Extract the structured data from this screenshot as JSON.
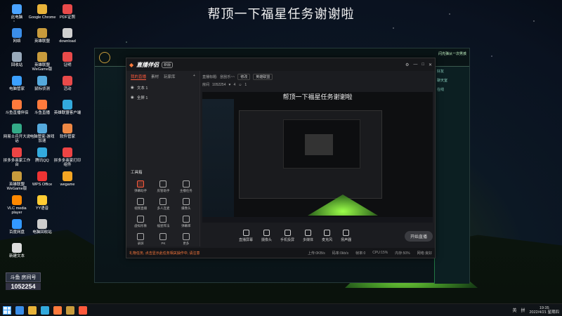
{
  "overlay_title": "帮顶一下福星任务谢谢啦",
  "desktop_icons": [
    {
      "label": "此电脑",
      "color": "#4aa3ff"
    },
    {
      "label": "Google Chrome",
      "color": "#e8b339"
    },
    {
      "label": "PDF证照",
      "color": "#e84a4a"
    },
    {
      "label": "网络",
      "color": "#3b8ee8"
    },
    {
      "label": "英雄联盟",
      "color": "#c89b3c"
    },
    {
      "label": "download",
      "color": "#d0d0d0"
    },
    {
      "label": "回收站",
      "color": "#9ab"
    },
    {
      "label": "英雄联盟WeGame版",
      "color": "#c89b3c"
    },
    {
      "label": "证明",
      "color": "#e84a4a"
    },
    {
      "label": "电脑管家",
      "color": "#3ba0ff"
    },
    {
      "label": "鼠标侦测",
      "color": "#5ad"
    },
    {
      "label": "活动",
      "color": "#e84a4a"
    },
    {
      "label": "斗鱼直播伴侣",
      "color": "#ff7a3c"
    },
    {
      "label": "斗鱼直播",
      "color": "#ff7a3c"
    },
    {
      "label": "英雄联盟客户端",
      "color": "#3ad"
    },
    {
      "label": "网易士兵开大说话",
      "color": "#3a8"
    },
    {
      "label": "电脑管家-游戏加速",
      "color": "#5ad"
    },
    {
      "label": "软件管家",
      "color": "#e84"
    },
    {
      "label": "拼多多商家工作台",
      "color": "#e44"
    },
    {
      "label": "腾讯QQ",
      "color": "#3ad"
    },
    {
      "label": "拼多多商家打印组件",
      "color": "#e44"
    },
    {
      "label": "英雄联盟WeGame版",
      "color": "#c89b3c"
    },
    {
      "label": "WPS Office",
      "color": "#e33"
    },
    {
      "label": "wegame",
      "color": "#f5a623"
    },
    {
      "label": "VLC media player",
      "color": "#f80"
    },
    {
      "label": "YY语音",
      "color": "#fc3"
    },
    {
      "label": "百度网盘",
      "color": "#39f"
    },
    {
      "label": "电脑回收站",
      "color": "#ccc"
    },
    {
      "label": "新建文本",
      "color": "#ddd"
    }
  ],
  "watermark": {
    "brand": "斗鱼 房间号",
    "room": "1052254"
  },
  "app": {
    "brand": "直播伴侣",
    "version": "新版",
    "tabs": [
      "我的直播",
      "素材",
      "玩家库"
    ],
    "scenes": [
      "文本 1",
      "全屏 1"
    ],
    "tools_title": "工具箱",
    "tools": [
      {
        "label": "弹幕助手",
        "red": true
      },
      {
        "label": "房管助手",
        "red": false
      },
      {
        "label": "主播任务",
        "red": false
      },
      {
        "label": "视频直播",
        "red": false
      },
      {
        "label": "多人连麦",
        "red": false
      },
      {
        "label": "摄像头",
        "red": false
      },
      {
        "label": "虚拟形象",
        "red": false
      },
      {
        "label": "福星阵法",
        "red": false
      },
      {
        "label": "弹幕库",
        "red": false
      },
      {
        "label": "录屏",
        "red": false
      },
      {
        "label": "PK",
        "red": false
      },
      {
        "label": "更多",
        "red": false
      }
    ],
    "info": {
      "title_label": "直播标题:",
      "title_value": "刮刮乐~~",
      "edit_label": "修改",
      "category_label": "英雄联盟",
      "room_label": "房间",
      "room_id": "1052254",
      "likes": "4",
      "people": "1"
    },
    "preview_title": "帮顶一下福星任务谢谢啦",
    "controls": [
      "直播屏幕",
      "摄像头",
      "手机投屏",
      "多媒体",
      "麦克风",
      "扬声器"
    ],
    "start_label": "开始直播",
    "status_warning": "礼物任务, 点击显示此任务相关操作中, 请注意",
    "status_stats": [
      "上传:0KB/s",
      "码率:0kb/s",
      "帧率:0",
      "CPU:15%",
      "内存:50%",
      "网络:良好"
    ]
  },
  "lol": {
    "profile": "闪光弹从一次男孩",
    "chat": [
      "好友",
      "聊天室",
      "在线"
    ]
  },
  "taskbar": {
    "time": "19:35",
    "date": "2022/4/21 星期四",
    "tray": [
      "英",
      "拼"
    ]
  }
}
